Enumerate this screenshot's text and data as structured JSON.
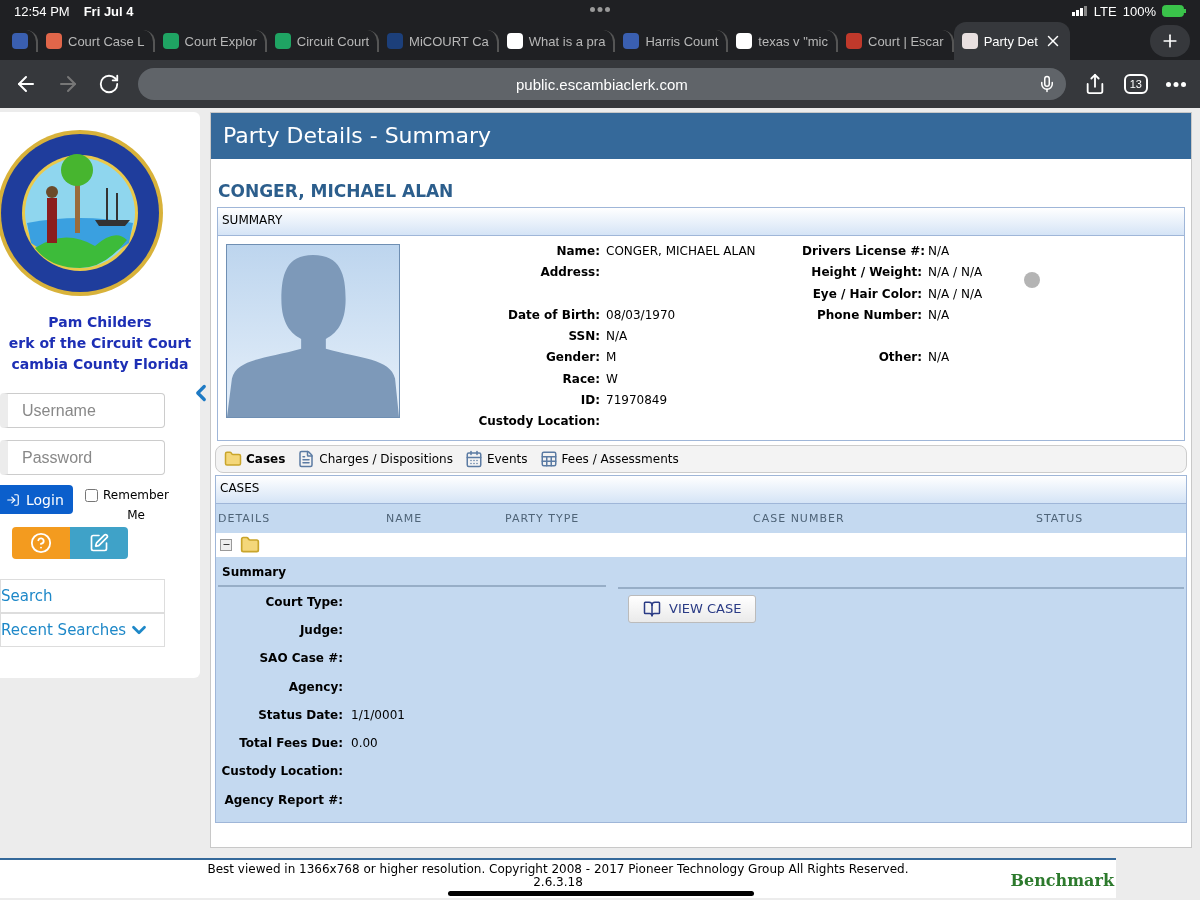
{
  "status_bar": {
    "time": "12:54 PM",
    "date": "Fri Jul 4",
    "network": "LTE",
    "battery": "100%"
  },
  "browser_tabs": [
    {
      "selected": false,
      "color": "#3a5fb0"
    },
    {
      "title": "Court Case L",
      "selected": false,
      "color": "#e0664a"
    },
    {
      "title": "Court Explor",
      "selected": false,
      "color": "#1fa463"
    },
    {
      "title": "Circuit Court",
      "selected": false,
      "color": "#1fa463"
    },
    {
      "title": "MiCOURT Ca",
      "selected": false,
      "color": "#1c3f7a"
    },
    {
      "title": "What is a pra",
      "selected": false,
      "color": "#ffffff"
    },
    {
      "title": "Harris Count",
      "selected": false,
      "color": "#3a5fb0"
    },
    {
      "title": "texas v \"mic",
      "selected": false,
      "color": "#ffffff"
    },
    {
      "title": "Court | Escar",
      "selected": false,
      "color": "#c0392b"
    },
    {
      "title": "Party Det",
      "selected": true,
      "color": "#e8e0e0"
    }
  ],
  "address_bar": {
    "url": "public.escambiaclerk.com",
    "tab_count": "13"
  },
  "sidebar": {
    "clerk_lines": [
      "Pam Childers",
      "erk of the Circuit Court",
      "cambia County Florida"
    ],
    "username": {
      "placeholder": "Username"
    },
    "password": {
      "placeholder": "Password"
    },
    "login": "Login",
    "remember": {
      "label": "Remember Me",
      "checked": false
    },
    "links": [
      {
        "label": "Search",
        "expandable": false
      },
      {
        "label": "Recent Searches",
        "expandable": true
      }
    ]
  },
  "page": {
    "title": "Party Details - Summary",
    "party_name": "CONGER, MICHAEL ALAN",
    "summary_heading": "SUMMARY",
    "summary_rows": [
      {
        "left": {
          "label": "Name:",
          "value": "CONGER, MICHAEL ALAN"
        },
        "right": {
          "label": "Drivers License #:",
          "value": "N/A"
        }
      },
      {
        "left": {
          "label": "Address:"
        },
        "right": {
          "label": "Height / Weight:",
          "value": "N/A / N/A"
        }
      },
      {
        "right": {
          "label": "Eye / Hair Color:",
          "value": "N/A / N/A"
        }
      },
      {
        "left": {
          "label": "Date of Birth:",
          "value": "08/03/1970"
        },
        "right": {
          "label": "Phone Number:",
          "value": "N/A"
        }
      },
      {
        "left": {
          "label": "SSN:",
          "value": "N/A"
        }
      },
      {
        "left": {
          "label": "Gender:",
          "value": "M"
        },
        "right": {
          "label": "Other:",
          "value": "N/A"
        }
      },
      {
        "left": {
          "label": "Race:",
          "value": "W"
        }
      },
      {
        "left": {
          "label": "ID:",
          "value": "71970849"
        }
      },
      {
        "left": {
          "label": "Custody Location:"
        }
      }
    ],
    "tabs": [
      {
        "label": "Cases",
        "selected": true
      },
      {
        "label": "Charges / Dispositions",
        "selected": false
      },
      {
        "label": "Events",
        "selected": false
      },
      {
        "label": "Fees / Assessments",
        "selected": false
      }
    ],
    "cases": {
      "heading": "CASES",
      "columns": [
        "DETAILS",
        "NAME",
        "PARTY TYPE",
        "CASE NUMBER",
        "STATUS"
      ],
      "row": {
        "expanded": true
      },
      "detail_heading": "Summary",
      "fields": [
        {
          "label": "Court Type:"
        },
        {
          "label": "Judge:"
        },
        {
          "label": "SAO Case #:"
        },
        {
          "label": "Agency:"
        },
        {
          "label": "Status Date:",
          "value": "1/1/0001"
        },
        {
          "label": "Total Fees Due:",
          "value": "0.00"
        },
        {
          "label": "Custody Location:"
        },
        {
          "label": "Agency Report #:"
        }
      ],
      "view_button": "VIEW CASE"
    }
  },
  "footer": {
    "text": "Best viewed in 1366x768 or higher resolution. Copyright 2008 - 2017 Pioneer Technology Group All Rights Reserved.",
    "version": "2.6.3.18",
    "logo": "Benchmark"
  }
}
